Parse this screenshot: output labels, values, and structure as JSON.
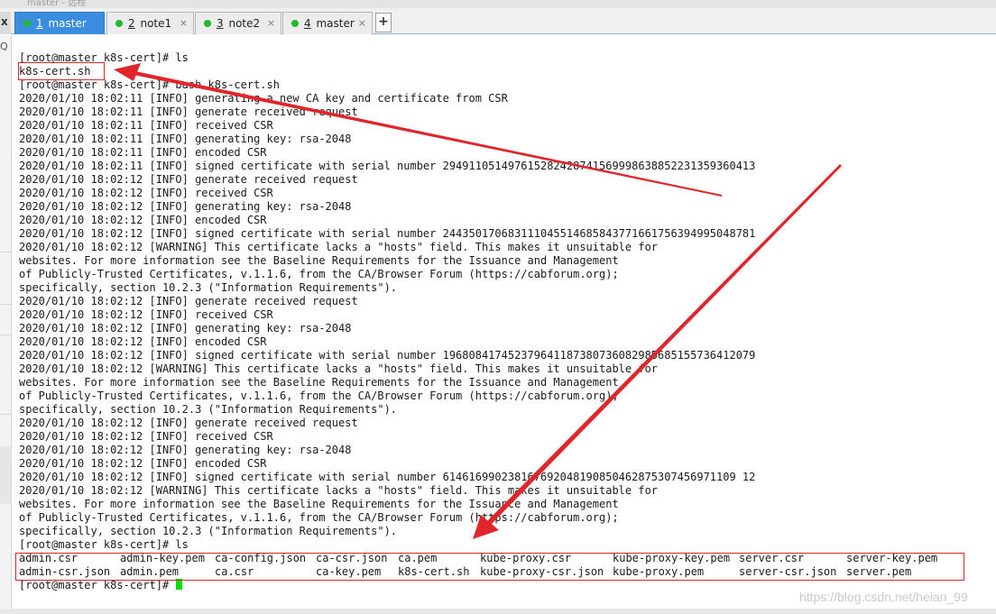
{
  "window": {
    "title": "master - 远程"
  },
  "tabs": [
    {
      "num": "1",
      "name": "master",
      "active": true
    },
    {
      "num": "2",
      "name": "note1",
      "active": false
    },
    {
      "num": "3",
      "name": "note2",
      "active": false
    },
    {
      "num": "4",
      "name": "master",
      "active": false
    }
  ],
  "tab_close_glyph": "×",
  "add_tab_glyph": "+",
  "side": {
    "close_glyph": "x",
    "search_glyph": "Q"
  },
  "terminal": {
    "lines": [
      "[root@master k8s-cert]# ls",
      "k8s-cert.sh",
      "[root@master k8s-cert]# bash k8s-cert.sh",
      "2020/01/10 18:02:11 [INFO] generating a new CA key and certificate from CSR",
      "2020/01/10 18:02:11 [INFO] generate received request",
      "2020/01/10 18:02:11 [INFO] received CSR",
      "2020/01/10 18:02:11 [INFO] generating key: rsa-2048",
      "2020/01/10 18:02:11 [INFO] encoded CSR",
      "2020/01/10 18:02:11 [INFO] signed certificate with serial number 294911051497615282428741569998638852231359360413",
      "2020/01/10 18:02:12 [INFO] generate received request",
      "2020/01/10 18:02:12 [INFO] received CSR",
      "2020/01/10 18:02:12 [INFO] generating key: rsa-2048",
      "2020/01/10 18:02:12 [INFO] encoded CSR",
      "2020/01/10 18:02:12 [INFO] signed certificate with serial number 244350170683111045514685843771661756394995048781",
      "2020/01/10 18:02:12 [WARNING] This certificate lacks a \"hosts\" field. This makes it unsuitable for",
      "websites. For more information see the Baseline Requirements for the Issuance and Management",
      "of Publicly-Trusted Certificates, v.1.1.6, from the CA/Browser Forum (https://cabforum.org);",
      "specifically, section 10.2.3 (\"Information Requirements\").",
      "2020/01/10 18:02:12 [INFO] generate received request",
      "2020/01/10 18:02:12 [INFO] received CSR",
      "2020/01/10 18:02:12 [INFO] generating key: rsa-2048",
      "2020/01/10 18:02:12 [INFO] encoded CSR",
      "2020/01/10 18:02:12 [INFO] signed certificate with serial number 196808417452379641187380736082985685155736412079",
      "2020/01/10 18:02:12 [WARNING] This certificate lacks a \"hosts\" field. This makes it unsuitable for",
      "websites. For more information see the Baseline Requirements for the Issuance and Management",
      "of Publicly-Trusted Certificates, v.1.1.6, from the CA/Browser Forum (https://cabforum.org);",
      "specifically, section 10.2.3 (\"Information Requirements\").",
      "2020/01/10 18:02:12 [INFO] generate received request",
      "2020/01/10 18:02:12 [INFO] received CSR",
      "2020/01/10 18:02:12 [INFO] generating key: rsa-2048",
      "2020/01/10 18:02:12 [INFO] encoded CSR",
      "2020/01/10 18:02:12 [INFO] signed certificate with serial number 614616990238167692048190850462875307456971109 12",
      "2020/01/10 18:02:12 [WARNING] This certificate lacks a \"hosts\" field. This makes it unsuitable for",
      "websites. For more information see the Baseline Requirements for the Issuance and Management",
      "of Publicly-Trusted Certificates, v.1.1.6, from the CA/Browser Forum (https://cabforum.org);",
      "specifically, section 10.2.3 (\"Information Requirements\").",
      "[root@master k8s-cert]# ls"
    ],
    "ls_rows": [
      [
        "admin.csr",
        "admin-key.pem",
        "ca-config.json",
        "ca-csr.json",
        "ca.pem",
        "kube-proxy.csr",
        "kube-proxy-key.pem",
        "server.csr",
        "server-key.pem"
      ],
      [
        "admin-csr.json",
        "admin.pem",
        "ca.csr",
        "ca-key.pem",
        "k8s-cert.sh",
        "kube-proxy-csr.json",
        "kube-proxy.pem",
        "server-csr.json",
        "server.pem"
      ]
    ],
    "prompt": "[root@master k8s-cert]# "
  },
  "annotation_color": "#e0262a",
  "watermark": "https://blog.csdn.net/heian_99"
}
